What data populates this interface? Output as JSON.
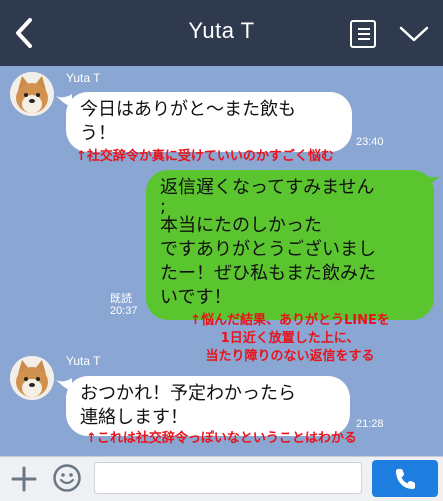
{
  "header": {
    "title": "Yuta T"
  },
  "messages": [
    {
      "sender": "Yuta T",
      "text_lines": [
        "今日はありがと〜また飲も",
        "う！"
      ],
      "time": "23:40"
    },
    {
      "text_lines": [
        "返信遅くなってすみません",
        ";",
        "本当にたのしかった",
        "ですありがとうございまし",
        "たー！ぜひ私もまた飲みた",
        "いです！"
      ],
      "read_label": "既読",
      "time": "20:37"
    },
    {
      "sender": "Yuta T",
      "text_lines": [
        "おつかれ！予定わかったら",
        "連絡します！"
      ],
      "time": "21:28"
    }
  ],
  "annotations": {
    "note1": "↑社交辞令か真に受けていいのかすごく悩む",
    "note2_lines": [
      "↑悩んだ結果、ありがとうLINEを",
      "1日近く放置した上に、",
      "当たり障りのない返信をする"
    ],
    "note3": "↑これは社交辞令っぽいなということはわかる"
  },
  "composer": {
    "placeholder": ""
  },
  "colors": {
    "header_bg": "#2f3a4f",
    "chat_bg": "#8aa6d3",
    "outgoing_bubble": "#5ac52f",
    "annotation_red": "#e8131b",
    "send_button": "#1e7fe0"
  },
  "icons": [
    "back-chevron-icon",
    "menu-list-icon",
    "chevron-down-icon",
    "plus-icon",
    "smiley-icon",
    "phone-icon",
    "avatar-shiba-icon"
  ]
}
